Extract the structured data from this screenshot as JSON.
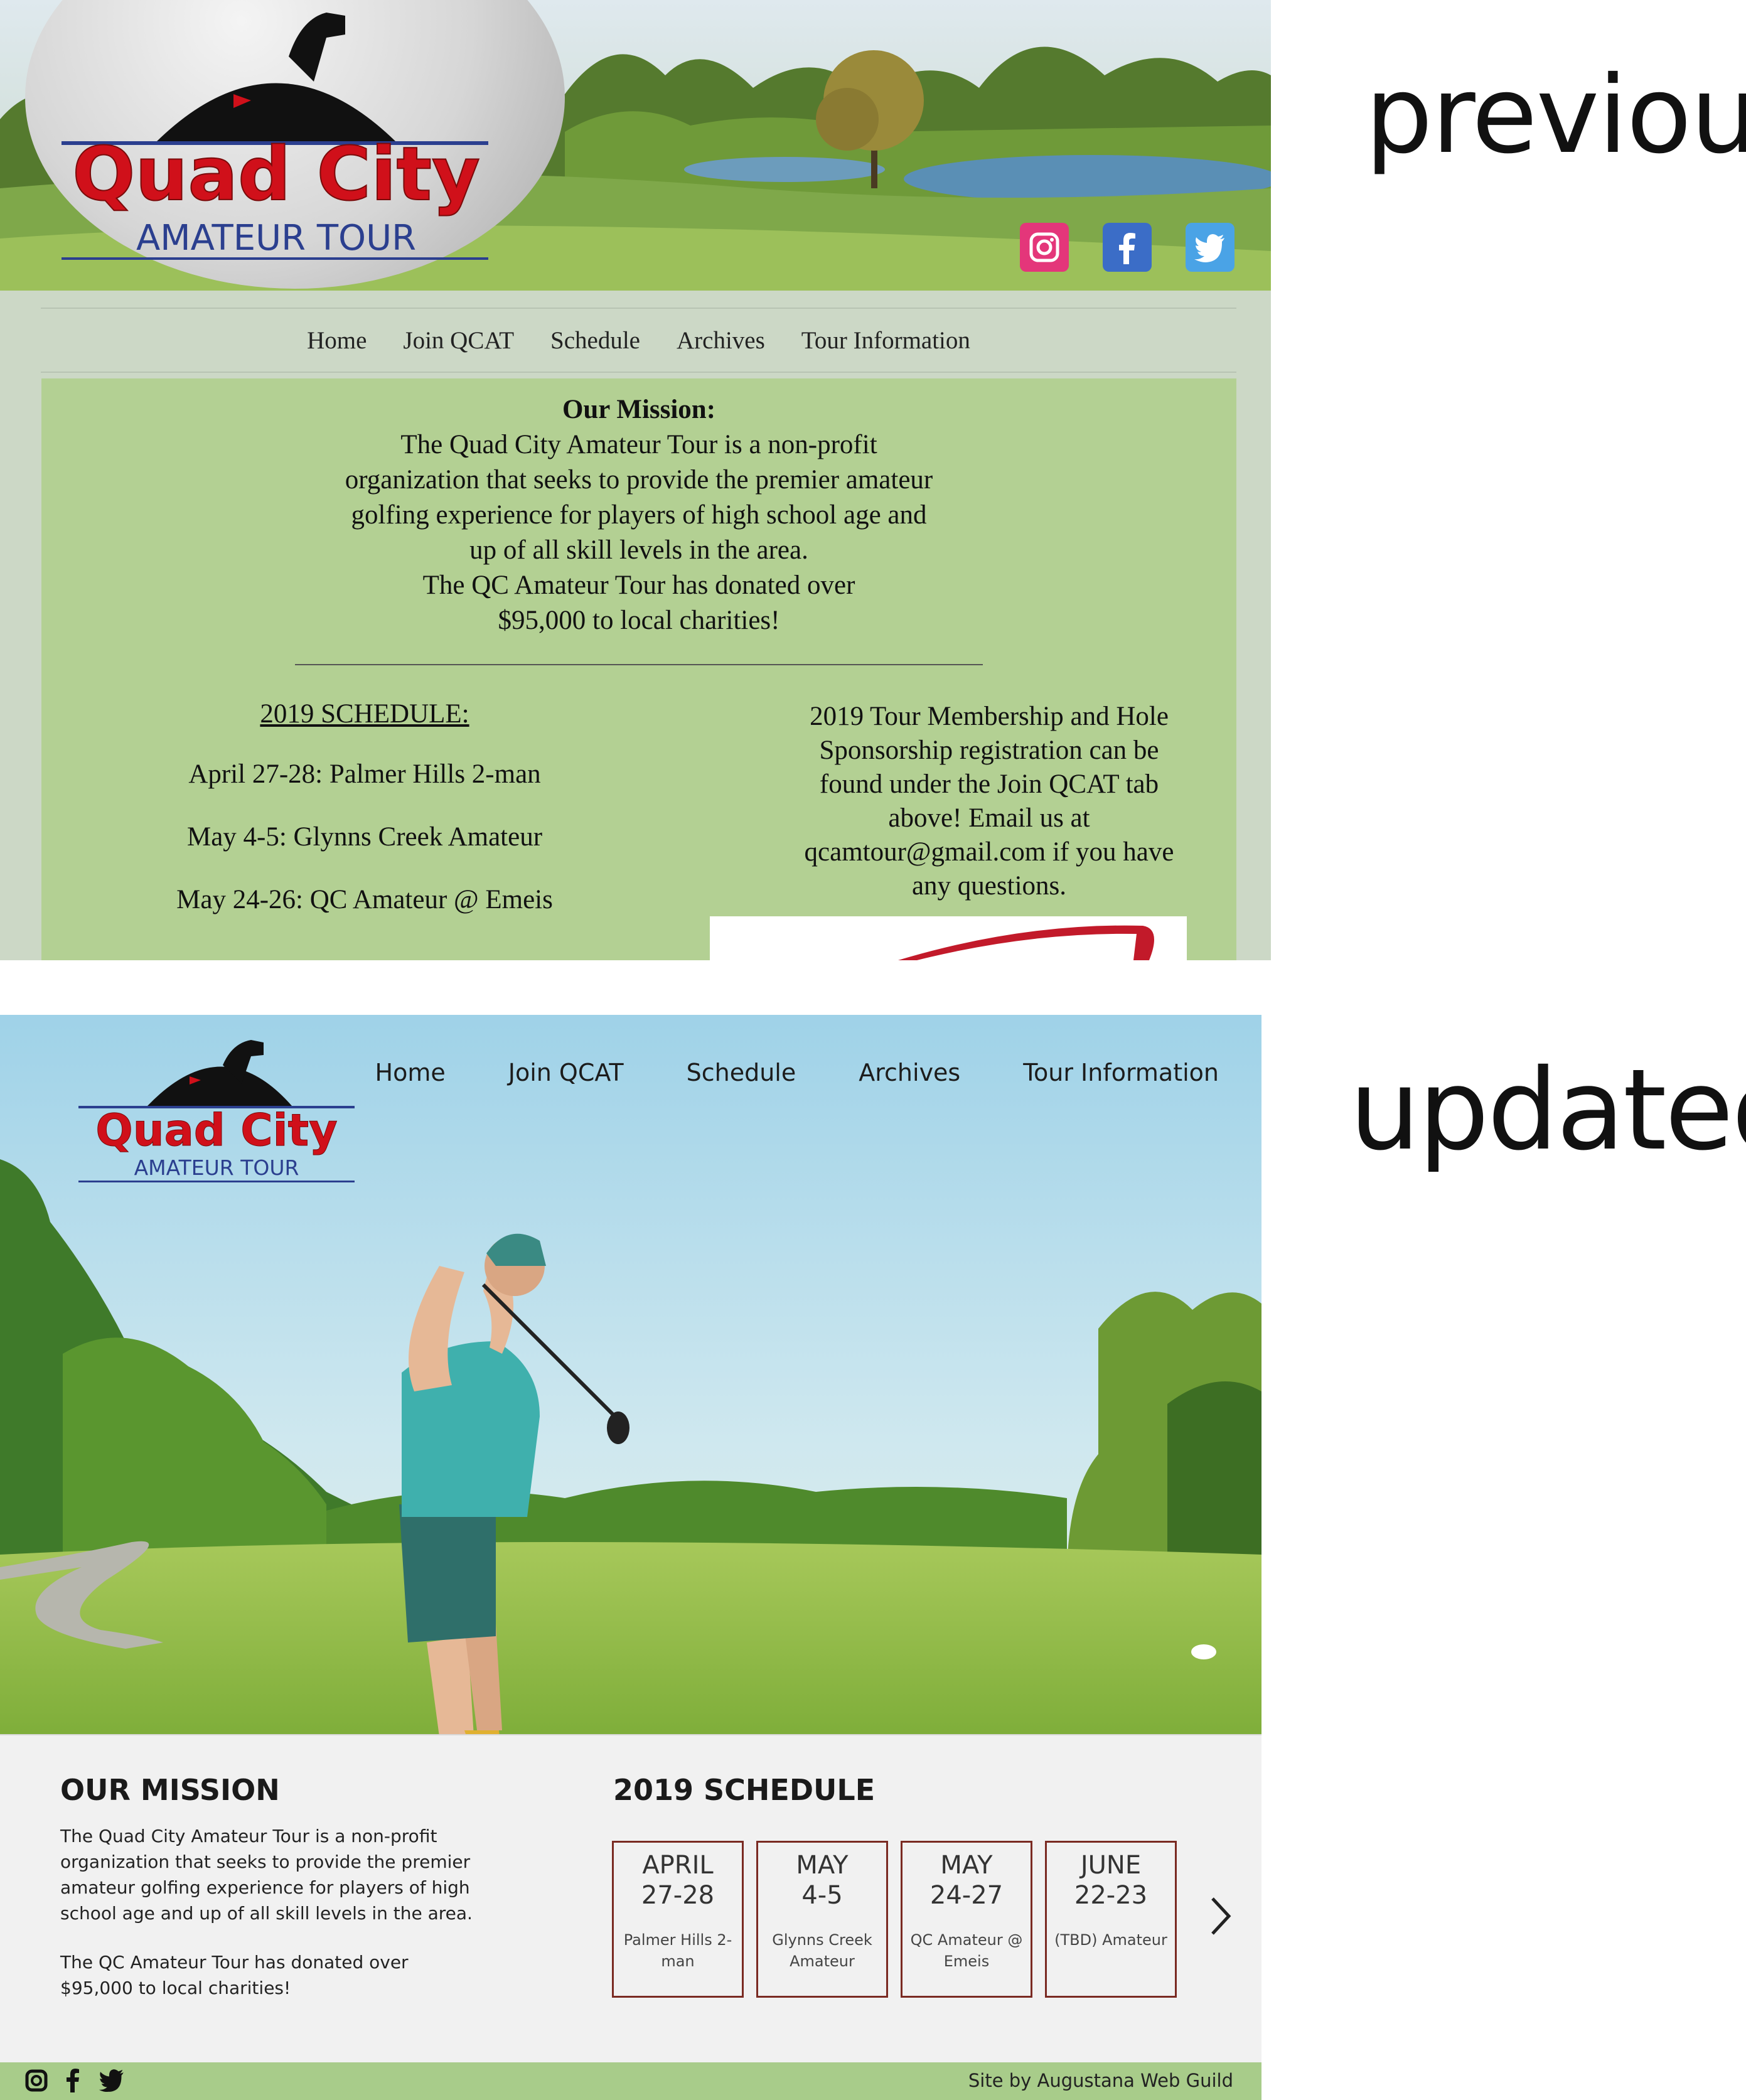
{
  "labels": {
    "previous": "previous",
    "updated": "updated"
  },
  "previous_site": {
    "logo": {
      "line1": "Quad City",
      "line2": "AMATEUR TOUR"
    },
    "social": [
      "instagram-icon",
      "facebook-icon",
      "twitter-icon"
    ],
    "nav": [
      "Home",
      "Join QCAT",
      "Schedule",
      "Archives",
      "Tour Information"
    ],
    "mission": {
      "title": "Our Mission:",
      "lines": [
        "The Quad City Amateur Tour is a non-profit",
        "organization that seeks to provide the premier amateur",
        "golfing experience for players of high school age and",
        "up of all skill levels in the area.",
        "The QC Amateur Tour has donated over",
        "$95,000 to local charities!"
      ]
    },
    "schedule": {
      "title": "2019 SCHEDULE:",
      "items": [
        "April 27-28: Palmer Hills 2-man",
        "May 4-5: Glynns Creek Amateur",
        "May 24-26: QC Amateur @ Emeis"
      ]
    },
    "membership_lines": [
      "2019 Tour Membership and Hole",
      "Sponsorship registration can be",
      "found under the Join QCAT tab",
      "above! Email us at",
      "qcamtour@gmail.com if you have",
      "any questions."
    ],
    "colors": {
      "page_bg": "#ccd8c6",
      "content_bg": "#b3d093",
      "logo_red": "#d0101a",
      "logo_blue": "#2b3f8f"
    }
  },
  "updated_site": {
    "logo": {
      "line1": "Quad City",
      "line2": "AMATEUR TOUR"
    },
    "nav": [
      "Home",
      "Join QCAT",
      "Schedule",
      "Archives",
      "Tour Information"
    ],
    "mission": {
      "title": "OUR MISSION",
      "paragraph1": "The Quad City Amateur Tour is a non-profit organization that seeks to provide the premier amateur golfing experience for players of high school age and up of all skill levels in the area.",
      "paragraph2": "The QC Amateur Tour has donated over $95,000 to local charities!"
    },
    "schedule": {
      "title": "2019 SCHEDULE",
      "cards": [
        {
          "month": "APRIL",
          "dates": "27-28",
          "name": "Palmer Hills 2-man"
        },
        {
          "month": "MAY",
          "dates": "4-5",
          "name": "Glynns Creek Amateur"
        },
        {
          "month": "MAY",
          "dates": "24-27",
          "name": "QC Amateur @ Emeis"
        },
        {
          "month": "JUNE",
          "dates": "22-23",
          "name": "(TBD) Amateur"
        }
      ],
      "next_icon": "chevron-right-icon"
    },
    "footer": {
      "icons": [
        "instagram-icon",
        "facebook-icon",
        "twitter-icon"
      ],
      "credit": "Site by Augustana Web Guild"
    },
    "colors": {
      "footer_bg": "#a8cc8a",
      "card_border": "#7a2a22",
      "panel_bg": "#f1f1f1"
    }
  }
}
